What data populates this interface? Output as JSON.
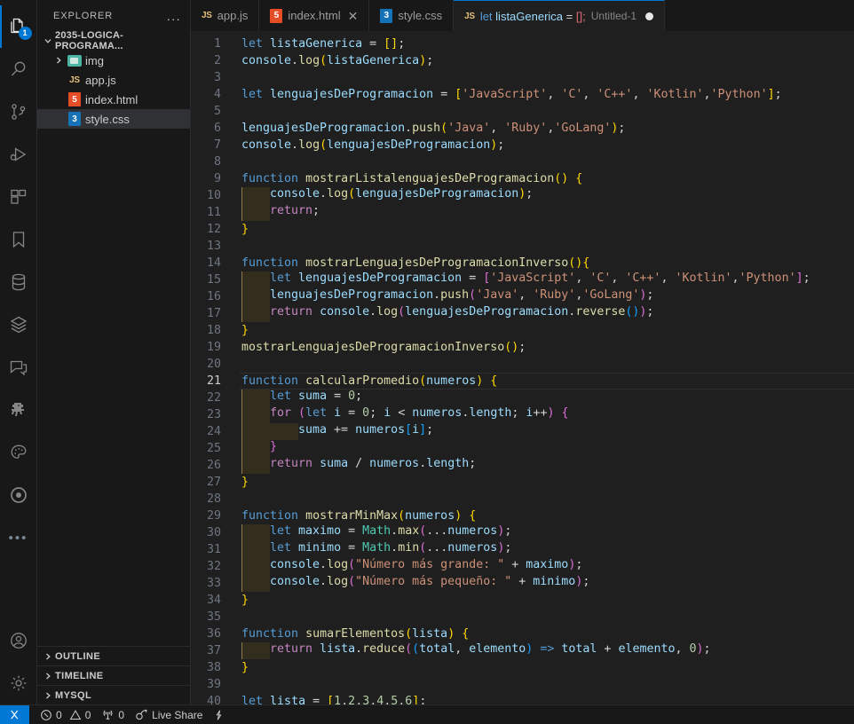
{
  "activity_bar": {
    "items": [
      {
        "name": "explorer",
        "icon": "files-icon",
        "badge": "1",
        "active": true
      },
      {
        "name": "search",
        "icon": "search-icon",
        "badge": null,
        "active": false
      },
      {
        "name": "source-control",
        "icon": "source-control-icon",
        "badge": null,
        "active": false
      },
      {
        "name": "run-and-debug",
        "icon": "run-debug-icon",
        "badge": null,
        "active": false
      },
      {
        "name": "extensions",
        "icon": "extensions-icon",
        "badge": null,
        "active": false
      },
      {
        "name": "bookmarks",
        "icon": "bookmark-icon",
        "badge": null,
        "active": false
      },
      {
        "name": "database",
        "icon": "database-icon",
        "badge": null,
        "active": false
      },
      {
        "name": "layers",
        "icon": "layers-icon",
        "badge": null,
        "active": false
      },
      {
        "name": "comments",
        "icon": "comment-icon",
        "badge": null,
        "active": false
      },
      {
        "name": "dinosaur",
        "icon": "dinosaur-icon",
        "badge": null,
        "active": false
      },
      {
        "name": "themes",
        "icon": "paint-palette-icon",
        "badge": null,
        "active": false
      },
      {
        "name": "ionic",
        "icon": "target-circle-icon",
        "badge": null,
        "active": false
      },
      {
        "name": "additional-views",
        "icon": "ellipsis-icon",
        "badge": null,
        "active": false
      }
    ],
    "bottom_items": [
      {
        "name": "accounts",
        "icon": "account-icon"
      },
      {
        "name": "manage",
        "icon": "gear-icon"
      }
    ]
  },
  "sidebar": {
    "header_title": "EXPLORER",
    "more_actions": "...",
    "root_folder": "2035-LOGICA-PROGRAMA...",
    "items": [
      {
        "label": "img",
        "icon": "folder-image-icon",
        "type": "folder",
        "expanded": false,
        "selected": false
      },
      {
        "label": "app.js",
        "icon": "js-file-icon",
        "type": "file",
        "selected": false
      },
      {
        "label": "index.html",
        "icon": "html-file-icon",
        "type": "file",
        "selected": false
      },
      {
        "label": "style.css",
        "icon": "css-file-icon",
        "type": "file",
        "selected": true
      }
    ],
    "bottom_panels": [
      {
        "label": "OUTLINE",
        "expanded": false
      },
      {
        "label": "TIMELINE",
        "expanded": false
      },
      {
        "label": "MYSQL",
        "expanded": false
      }
    ]
  },
  "tabs": [
    {
      "label": "app.js",
      "icon": "js-file-icon",
      "active": false,
      "dirty": false,
      "closable": false,
      "description": ""
    },
    {
      "label": "index.html",
      "icon": "html-file-icon",
      "active": false,
      "dirty": false,
      "closable": true,
      "description": ""
    },
    {
      "label": "style.css",
      "icon": "css-file-icon",
      "active": false,
      "dirty": false,
      "closable": false,
      "description": ""
    },
    {
      "label": "let listaGenerica = [];",
      "icon": "js-file-icon",
      "active": true,
      "dirty": true,
      "closable": false,
      "description": "Untitled-1"
    }
  ],
  "editor": {
    "language": "javascript",
    "active_line": 21,
    "first_visible_line": 1,
    "last_visible_line": 40,
    "lines": [
      {
        "n": 1,
        "text": "let listaGenerica = [];"
      },
      {
        "n": 2,
        "text": "console.log(listaGenerica);"
      },
      {
        "n": 3,
        "text": ""
      },
      {
        "n": 4,
        "text": "let lenguajesDeProgramacion = ['JavaScript', 'C', 'C++', 'Kotlin','Python'];"
      },
      {
        "n": 5,
        "text": ""
      },
      {
        "n": 6,
        "text": "lenguajesDeProgramacion.push('Java', 'Ruby','GoLang');"
      },
      {
        "n": 7,
        "text": "console.log(lenguajesDeProgramacion);"
      },
      {
        "n": 8,
        "text": ""
      },
      {
        "n": 9,
        "text": "function mostrarListalenguajesDeProgramacion() {"
      },
      {
        "n": 10,
        "text": "    console.log(lenguajesDeProgramacion);"
      },
      {
        "n": 11,
        "text": "    return;"
      },
      {
        "n": 12,
        "text": "}"
      },
      {
        "n": 13,
        "text": ""
      },
      {
        "n": 14,
        "text": "function mostrarLenguajesDeProgramacionInverso(){"
      },
      {
        "n": 15,
        "text": "    let lenguajesDeProgramacion = ['JavaScript', 'C', 'C++', 'Kotlin','Python'];"
      },
      {
        "n": 16,
        "text": "    lenguajesDeProgramacion.push('Java', 'Ruby','GoLang');"
      },
      {
        "n": 17,
        "text": "    return console.log(lenguajesDeProgramacion.reverse());"
      },
      {
        "n": 18,
        "text": "}"
      },
      {
        "n": 19,
        "text": "mostrarLenguajesDeProgramacionInverso();"
      },
      {
        "n": 20,
        "text": ""
      },
      {
        "n": 21,
        "text": "function calcularPromedio(numeros) {"
      },
      {
        "n": 22,
        "text": "    let suma = 0;"
      },
      {
        "n": 23,
        "text": "    for (let i = 0; i < numeros.length; i++) {"
      },
      {
        "n": 24,
        "text": "        suma += numeros[i];"
      },
      {
        "n": 25,
        "text": "    }"
      },
      {
        "n": 26,
        "text": "    return suma / numeros.length;"
      },
      {
        "n": 27,
        "text": "}"
      },
      {
        "n": 28,
        "text": ""
      },
      {
        "n": 29,
        "text": "function mostrarMinMax(numeros) {"
      },
      {
        "n": 30,
        "text": "    let maximo = Math.max(...numeros);"
      },
      {
        "n": 31,
        "text": "    let minimo = Math.min(...numeros);"
      },
      {
        "n": 32,
        "text": "    console.log(\"Número más grande: \" + maximo);"
      },
      {
        "n": 33,
        "text": "    console.log(\"Número más pequeño: \" + minimo);"
      },
      {
        "n": 34,
        "text": "}"
      },
      {
        "n": 35,
        "text": ""
      },
      {
        "n": 36,
        "text": "function sumarElementos(lista) {"
      },
      {
        "n": 37,
        "text": "    return lista.reduce((total, elemento) => total + elemento, 0);"
      },
      {
        "n": 38,
        "text": "}"
      },
      {
        "n": 39,
        "text": ""
      },
      {
        "n": 40,
        "text": "let lista = [1,2,3,4,5,6];"
      }
    ]
  },
  "status_bar": {
    "remote_icon": "remote-explorer-icon",
    "errors": "0",
    "warnings": "0",
    "ports": "0",
    "live_share": "Live Share",
    "editor_lightning": "lightning-icon"
  },
  "colors": {
    "accent": "#0078d4",
    "editor_bg": "#1f1f1f",
    "sidebar_bg": "#181818",
    "activitybar_bg": "#181818",
    "keyword": "#569cd6",
    "control": "#c586c0",
    "variable": "#9cdcfe",
    "function": "#dcdcaa",
    "string": "#ce9178",
    "number": "#b5cea8",
    "bracket1": "#ffd700",
    "bracket2": "#da70d6",
    "bracket3": "#179fff",
    "line_number": "#6e7681",
    "selection_bg": "#2f3134"
  }
}
